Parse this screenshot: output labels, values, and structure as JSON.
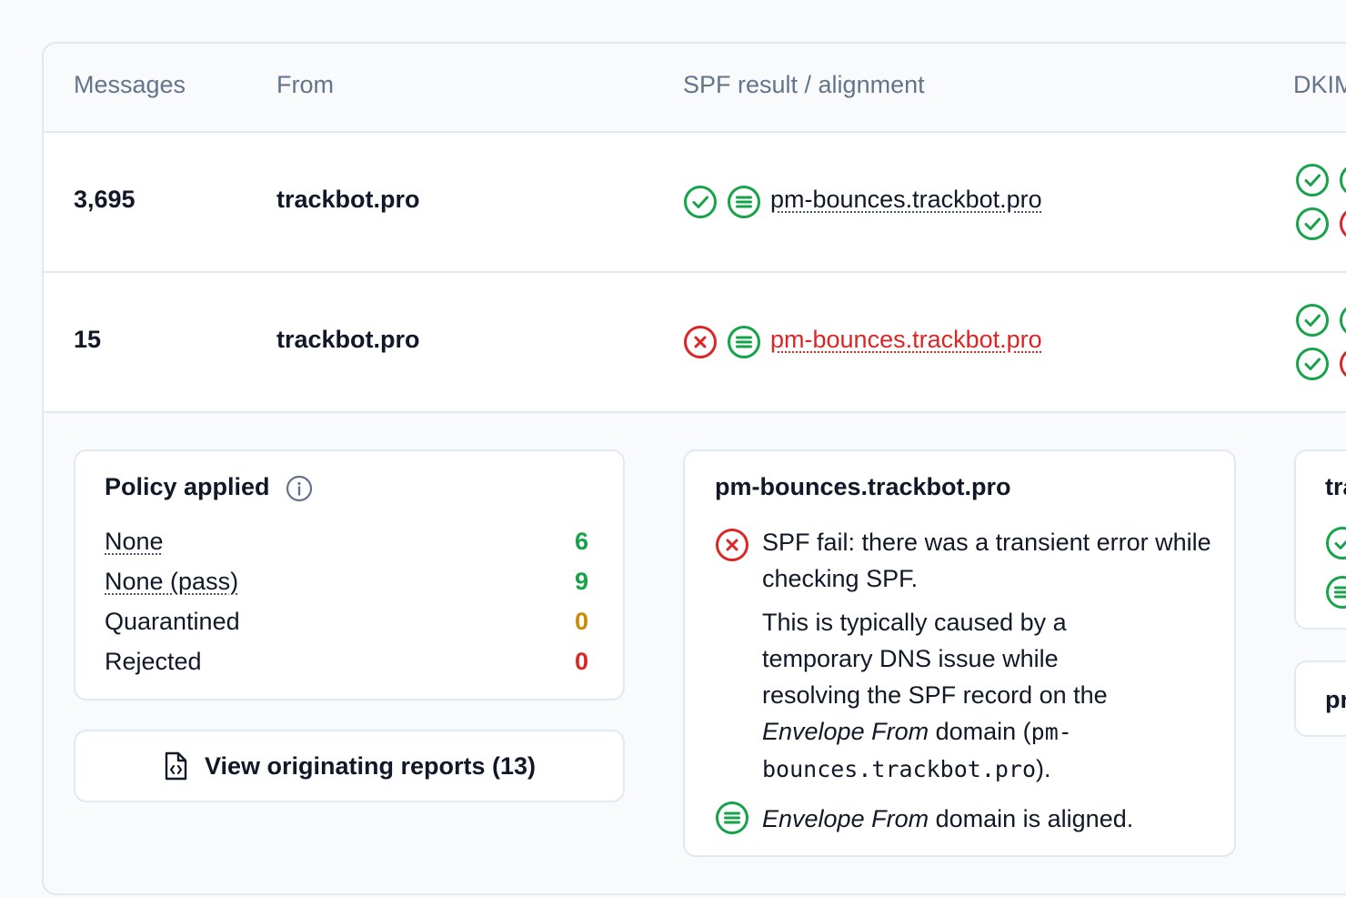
{
  "table": {
    "headers": {
      "messages": "Messages",
      "from": "From",
      "spf": "SPF result / alignment",
      "dkim": "DKIM"
    },
    "rows": [
      {
        "messages": "3,695",
        "from": "trackbot.pro",
        "spf_domain": "pm-bounces.trackbot.pro",
        "spf_result": "pass",
        "spf_alignment": "aligned"
      },
      {
        "messages": "15",
        "from": "trackbot.pro",
        "spf_domain": "pm-bounces.trackbot.pro",
        "spf_result": "fail",
        "spf_alignment": "aligned"
      }
    ]
  },
  "policy": {
    "title": "Policy applied",
    "items": [
      {
        "label": "None",
        "value": "6",
        "color": "#16a34a"
      },
      {
        "label": "None (pass)",
        "value": "9",
        "color": "#16a34a"
      },
      {
        "label": "Quarantined",
        "value": "0",
        "color": "#ca8a04"
      },
      {
        "label": "Rejected",
        "value": "0",
        "color": "#dc2626"
      }
    ]
  },
  "view_reports_button": "View originating reports (13)",
  "spf_detail": {
    "title": "pm-bounces.trackbot.pro",
    "fail_line": "SPF fail: there was a transient error while checking SPF.",
    "explain_before": "This is typically caused by a temporary DNS issue while resolving the SPF record on the ",
    "envelope_from": "Envelope From",
    "explain_middle": " domain (",
    "domain_mono_1": "pm-",
    "domain_mono_2": "bounces.trackbot.pro",
    "explain_after": ").",
    "aligned_rest": " domain is aligned."
  },
  "dkim_detail": {
    "title_fragment": "tra",
    "second_fragment": "pr"
  },
  "colors": {
    "pass": "#16a34a",
    "fail": "#dc2626",
    "warning": "#ca8a04"
  }
}
